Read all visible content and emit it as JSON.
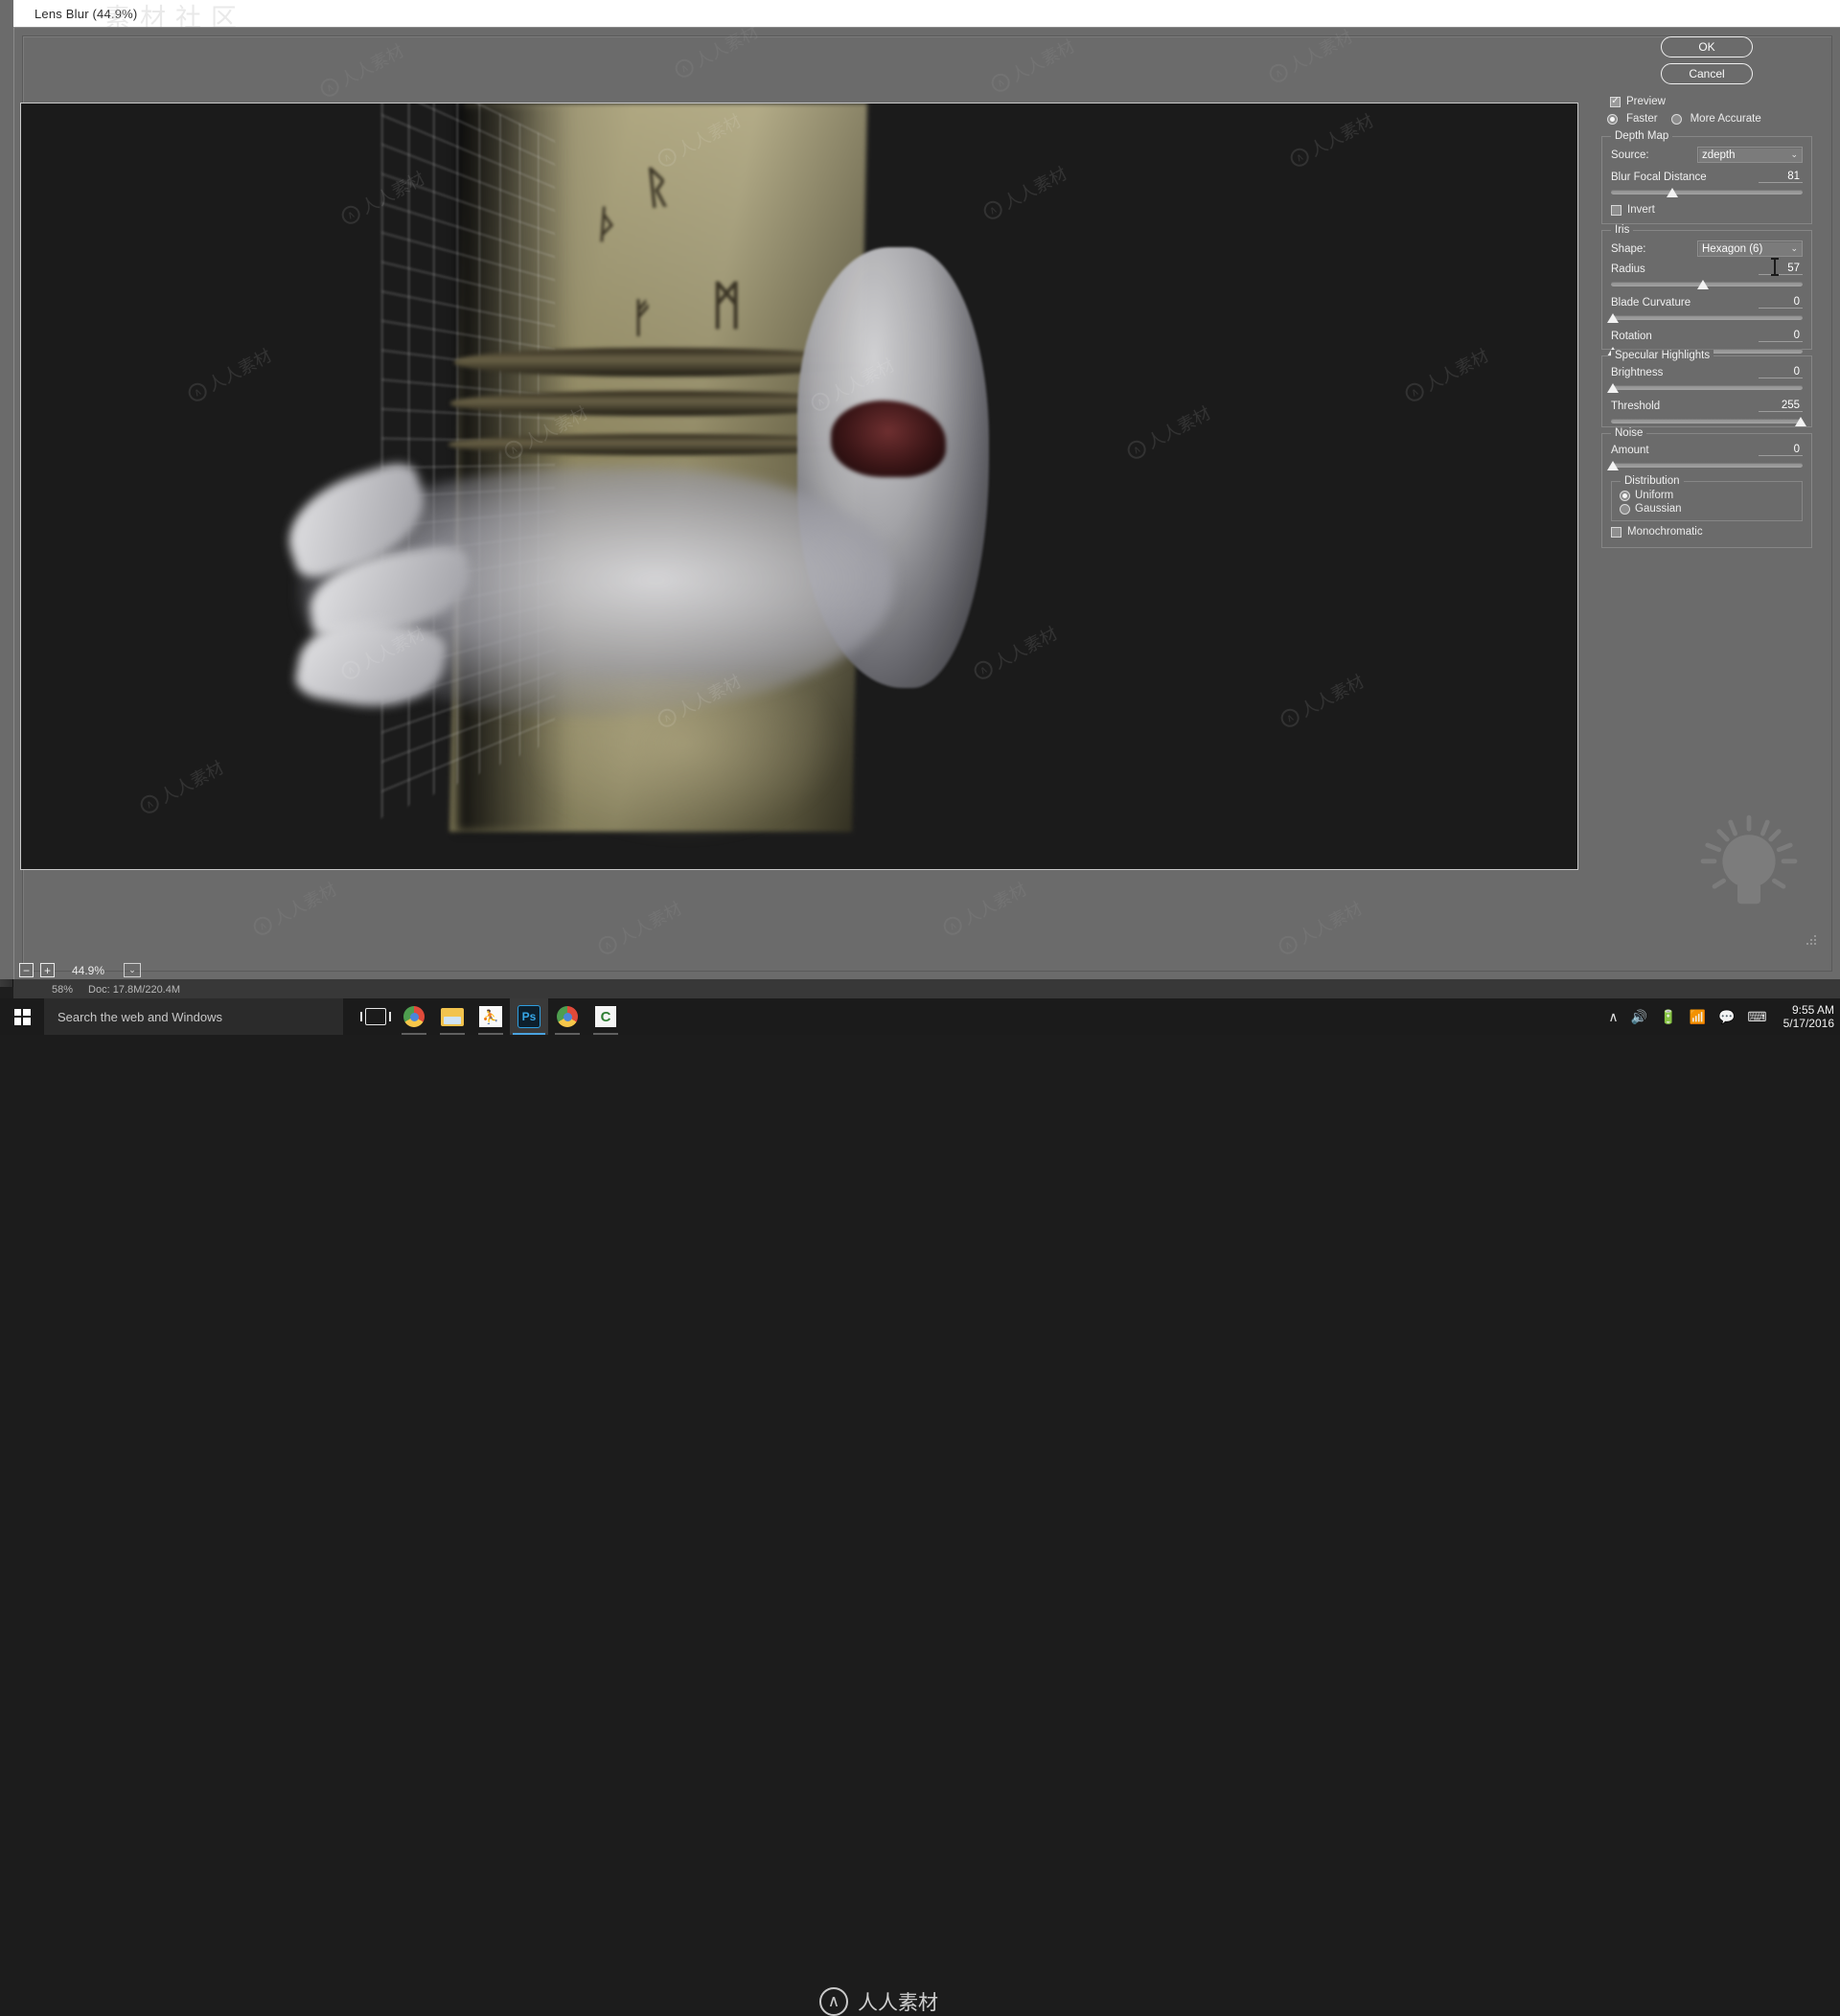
{
  "window": {
    "title": "Lens Blur (44.9%)",
    "watermark_title": "素材社区"
  },
  "preview": {
    "zoom_minus": "−",
    "zoom_plus": "+",
    "zoom_value": "44.9%",
    "zoom_caret": "⌄"
  },
  "options": {
    "ok_label": "OK",
    "cancel_label": "Cancel",
    "preview_label": "Preview",
    "preview_checked": "✓",
    "accuracy": {
      "faster_label": "Faster",
      "more_accurate_label": "More Accurate",
      "selected": "Faster"
    },
    "depth_map": {
      "legend": "Depth Map",
      "source_label": "Source:",
      "source_value": "zdepth",
      "caret": "⌄",
      "blur_focal_distance_label": "Blur Focal Distance",
      "blur_focal_distance_value": "81",
      "invert_label": "Invert",
      "invert_checked": false
    },
    "iris": {
      "legend": "Iris",
      "shape_label": "Shape:",
      "shape_value": "Hexagon (6)",
      "caret": "⌄",
      "radius_label": "Radius",
      "radius_value": "57",
      "blade_curvature_label": "Blade Curvature",
      "blade_curvature_value": "0",
      "rotation_label": "Rotation",
      "rotation_value": "0"
    },
    "specular_highlights": {
      "legend": "Specular Highlights",
      "brightness_label": "Brightness",
      "brightness_value": "0",
      "threshold_label": "Threshold",
      "threshold_value": "255"
    },
    "noise": {
      "legend": "Noise",
      "amount_label": "Amount",
      "amount_value": "0",
      "distribution": {
        "legend": "Distribution",
        "uniform_label": "Uniform",
        "gaussian_label": "Gaussian",
        "selected": "Uniform"
      },
      "monochromatic_label": "Monochromatic",
      "monochromatic_checked": false
    }
  },
  "status_bar": {
    "zoom": "58%",
    "doc_info": "Doc: 17.8M/220.4M"
  },
  "watermark": {
    "logo_glyph": "∧",
    "text": "人人素材"
  },
  "taskbar": {
    "search_placeholder": "Search the web and Windows",
    "items": [
      {
        "name": "task-view",
        "label": "Task View"
      },
      {
        "name": "chrome",
        "label": "Google Chrome"
      },
      {
        "name": "file-explorer",
        "label": "File Explorer"
      },
      {
        "name": "runner-app",
        "label": "Application"
      },
      {
        "name": "photoshop",
        "label": "Ps"
      },
      {
        "name": "browser-360",
        "label": "Browser"
      },
      {
        "name": "green-app",
        "label": "C"
      }
    ],
    "tray": {
      "chevron": "∧",
      "volume": "🔊",
      "battery": "▭",
      "network": "◥",
      "action_center": "▣",
      "keyboard": "⌨",
      "time": "9:55 AM",
      "date": "5/17/2016"
    }
  },
  "colors": {
    "panel_gray": "#6b6b6b",
    "title_bar": "#ffffff",
    "preview_bg": "#1b1b1b",
    "taskbar": "#1b1b1b",
    "accent": "#4aa3e0"
  },
  "slider_positions": {
    "blur_focal_distance": 32,
    "radius": 57,
    "blade_curvature": 0,
    "rotation": 0,
    "brightness": 0,
    "threshold": 100,
    "noise_amount": 0
  }
}
